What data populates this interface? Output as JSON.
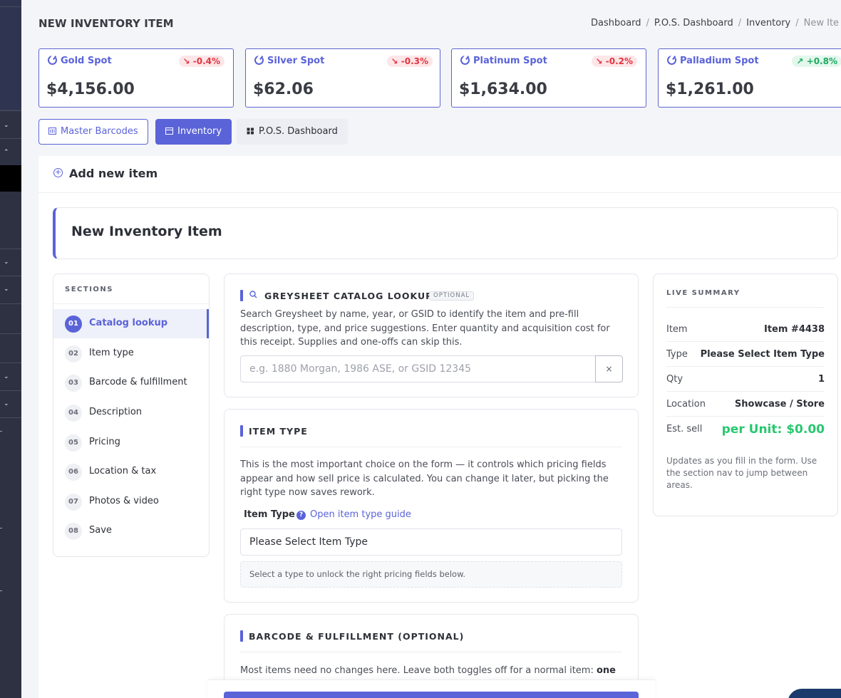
{
  "header": {
    "title": "NEW INVENTORY ITEM",
    "breadcrumb": [
      "Dashboard",
      "P.O.S. Dashboard",
      "Inventory",
      "New Ite"
    ]
  },
  "spots": [
    {
      "name": "Gold Spot",
      "change": "-0.4%",
      "direction": "down",
      "price": "$4,156.00"
    },
    {
      "name": "Silver Spot",
      "change": "-0.3%",
      "direction": "down",
      "price": "$62.06"
    },
    {
      "name": "Platinum Spot",
      "change": "-0.2%",
      "direction": "down",
      "price": "$1,634.00"
    },
    {
      "name": "Palladium Spot",
      "change": "+0.8%",
      "direction": "up",
      "price": "$1,261.00"
    }
  ],
  "tabs": {
    "master_barcodes": "Master Barcodes",
    "inventory": "Inventory",
    "pos_dashboard": "P.O.S. Dashboard"
  },
  "panel": {
    "add_label": "Add new item",
    "hero_title": "New Inventory Item"
  },
  "sections": {
    "heading": "SECTIONS",
    "items": [
      {
        "num": "01",
        "label": "Catalog lookup"
      },
      {
        "num": "02",
        "label": "Item type"
      },
      {
        "num": "03",
        "label": "Barcode & fulfillment"
      },
      {
        "num": "04",
        "label": "Description"
      },
      {
        "num": "05",
        "label": "Pricing"
      },
      {
        "num": "06",
        "label": "Location & tax"
      },
      {
        "num": "07",
        "label": "Photos & video"
      },
      {
        "num": "08",
        "label": "Save"
      }
    ]
  },
  "catalog": {
    "title": "GREYSHEET CATALOG LOOKUP",
    "badge": "OPTIONAL",
    "description": "Search Greysheet by name, year, or GSID to identify the item and pre-fill description, type, and price suggestions. Enter quantity and acquisition cost for this receipt. Supplies and one-offs can skip this.",
    "search_placeholder": "e.g. 1880 Morgan, 1986 ASE, or GSID 12345",
    "clear_label": "×"
  },
  "item_type": {
    "title": "ITEM TYPE",
    "description": "This is the most important choice on the form — it controls which pricing fields appear and how sell price is calculated. You can change it later, but picking the right type now saves rework.",
    "field_label": "Item Type",
    "guide_link": "Open item type guide",
    "selected": "Please Select Item Type",
    "hint": "Select a type to unlock the right pricing fields below."
  },
  "barcode": {
    "title": "BARCODE & FULFILLMENT (OPTIONAL)",
    "description_start": "Most items need no changes here. Leave both toggles off for a normal item: ",
    "description_bold": "one"
  },
  "summary": {
    "heading": "LIVE SUMMARY",
    "rows": [
      {
        "key": "Item",
        "value": "Item #4438"
      },
      {
        "key": "Type",
        "value": "Please Select Item Type"
      },
      {
        "key": "Qty",
        "value": "1"
      },
      {
        "key": "Location",
        "value": "Showcase / Store"
      },
      {
        "key": "Est. sell",
        "value": "per Unit: $0.00"
      }
    ],
    "note": "Updates as you fill in the form. Use the section nav to jump between areas."
  },
  "colors": {
    "accent": "#5a63d8",
    "sidebar": "#2d3142",
    "down": "#e3343f",
    "up": "#1ea860",
    "est_sell": "#28c76f"
  }
}
